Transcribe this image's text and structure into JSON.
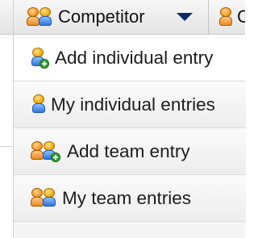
{
  "menubar": {
    "competitor_label": "Competitor",
    "next_label": "C",
    "icons": {
      "competitor": "team-icon",
      "next": "person-icon",
      "caret": "caret-down-icon"
    }
  },
  "dropdown": {
    "items": [
      {
        "label": "Add individual entry",
        "icon": "add-person-icon"
      },
      {
        "label": "My individual entries",
        "icon": "person-icon"
      },
      {
        "label": "Add team entry",
        "icon": "add-team-icon"
      },
      {
        "label": "My team entries",
        "icon": "team-icon"
      }
    ]
  }
}
